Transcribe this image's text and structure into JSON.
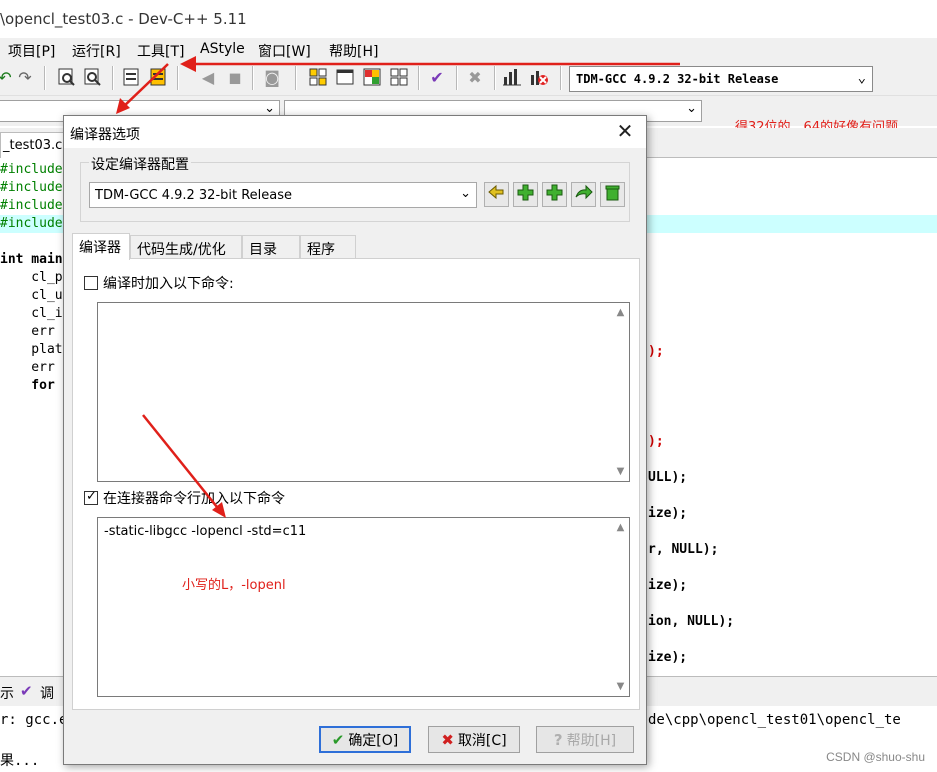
{
  "window": {
    "title": "\\opencl_test03.c - Dev-C++ 5.11"
  },
  "menu": [
    "项目[P]",
    "运行[R]",
    "工具[T]",
    "AStyle",
    "窗口[W]",
    "帮助[H]"
  ],
  "toolbar": {
    "compiler": "TDM-GCC 4.9.2 32-bit Release",
    "compiler_arrow": "⌄"
  },
  "annotations": {
    "top_note": "得32位的，64的好像有问题",
    "lowercase_note": "小写的L，-lopenl"
  },
  "editor": {
    "file_tab": "_test03.c",
    "lines": [
      {
        "text": "#include",
        "kind": "include"
      },
      {
        "text": "#include",
        "kind": "include"
      },
      {
        "text": "#include",
        "kind": "include"
      },
      {
        "text": "#include",
        "kind": "include"
      },
      {
        "text": "",
        "kind": "blank"
      },
      {
        "text": "int main",
        "kind": "kw"
      },
      {
        "text": "    cl_p",
        "kind": "var"
      },
      {
        "text": "    cl_u",
        "kind": "var"
      },
      {
        "text": "    cl_i",
        "kind": "var"
      },
      {
        "text": "    err ",
        "kind": "var"
      },
      {
        "text": "    plat",
        "kind": "var"
      },
      {
        "text": "    err ",
        "kind": "var"
      },
      {
        "text": "    for ",
        "kind": "kw"
      }
    ],
    "right_fragments": [
      {
        "text": ");",
        "red": true
      },
      {
        "text": ");",
        "red": true
      },
      {
        "text": "ULL);",
        "red": false
      },
      {
        "text": "ize);",
        "red": false
      },
      {
        "text": "r, NULL);",
        "red": false
      },
      {
        "text": "ize);",
        "red": false
      },
      {
        "text": "ion, NULL);",
        "red": false
      },
      {
        "text": "ize);",
        "red": false
      }
    ]
  },
  "bottom": {
    "tab1": "示",
    "tab2": "调",
    "log_line1": "r: gcc.e",
    "log_line1_tail": "de\\cpp\\opencl_test01\\opencl_te",
    "log_line2": "果..."
  },
  "watermark": "CSDN @shuo-shu",
  "dialog": {
    "title": "编译器选项",
    "close": "✕",
    "group_label": "设定编译器配置",
    "config_select": "TDM-GCC 4.9.2 32-bit Release",
    "tabs": [
      "编译器",
      "代码生成/优化",
      "目录",
      "程序"
    ],
    "compile_cmd_checkbox": "编译时加入以下命令:",
    "compile_cmd_checked": false,
    "compile_cmd_text": "",
    "linker_cmd_checkbox": "在连接器命令行加入以下命令",
    "linker_cmd_checked": true,
    "linker_cmd_text": "-static-libgcc -lopencl -std=c11",
    "ok_label": "确定[O]",
    "cancel_label": "取消[C]",
    "help_label": "帮助[H]"
  },
  "colors": {
    "annotation_red": "#e0201a",
    "include_green": "#008000",
    "highlight_cyan": "#ccffff",
    "ok_border_blue": "#2e6fd8"
  }
}
